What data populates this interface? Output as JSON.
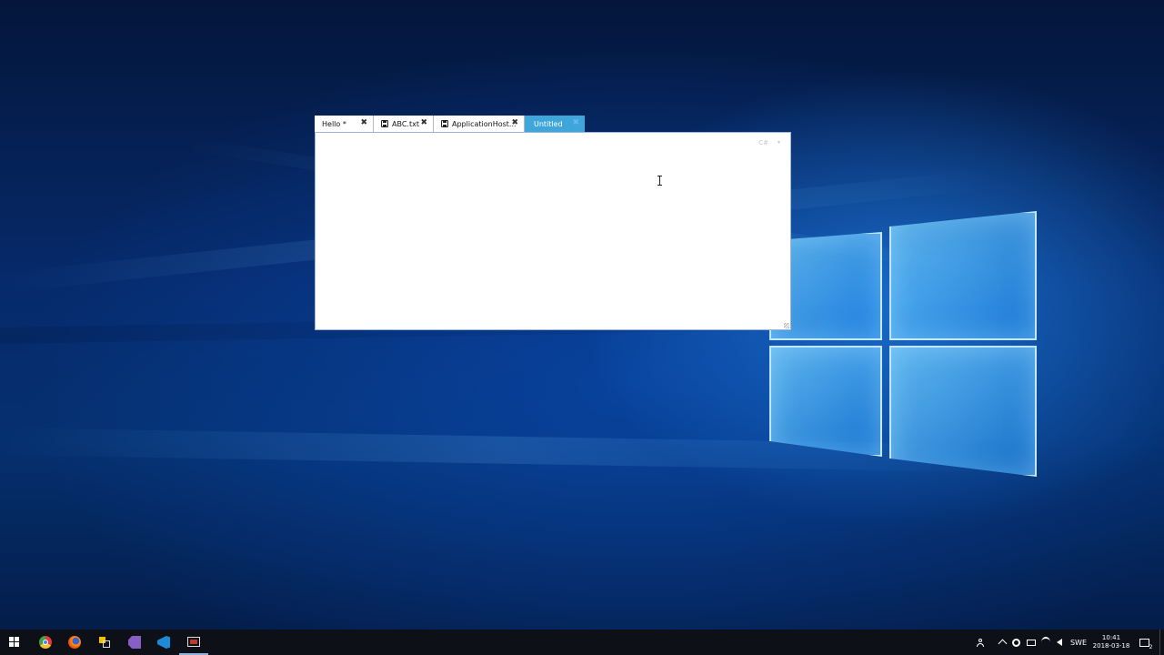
{
  "editor": {
    "tabs": [
      {
        "label": "Hello *",
        "close": "✖",
        "saved_icon": false,
        "active": false
      },
      {
        "label": "ABC.txt",
        "close": "✖",
        "saved_icon": true,
        "active": false
      },
      {
        "label": "ApplicationHost...",
        "close": "✖",
        "saved_icon": true,
        "active": true
      },
      {
        "label": "Untitled",
        "close": "✖",
        "saved_icon": false,
        "active": true
      }
    ],
    "language": "C#",
    "language_caret": "▾",
    "content": ""
  },
  "taskbar": {
    "pinned": [
      {
        "icon": "windows-start-icon"
      },
      {
        "icon": "chrome-icon"
      },
      {
        "icon": "firefox-icon"
      },
      {
        "icon": "tool-app-icon"
      },
      {
        "icon": "visual-studio-icon"
      },
      {
        "icon": "vscode-icon"
      },
      {
        "icon": "screen-app-icon"
      }
    ],
    "tray": {
      "language": "SWE",
      "time": "10:41",
      "date": "2018-03-18",
      "notification_count": "2"
    }
  },
  "colors": {
    "active_tab": "#3ea6da",
    "taskbar": "#0d1016"
  }
}
